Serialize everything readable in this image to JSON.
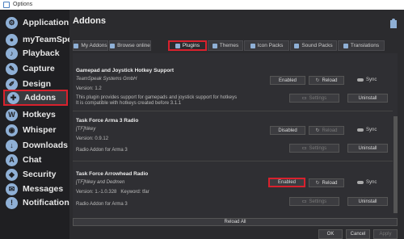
{
  "window": {
    "title": "Options"
  },
  "sidebar": {
    "items": [
      {
        "label": "Application",
        "icon": "gear-icon",
        "glyph": "⚙"
      },
      {
        "label": "myTeamSpeak",
        "icon": "user-icon",
        "glyph": "●"
      },
      {
        "label": "Playback",
        "icon": "speaker-icon",
        "glyph": "♪"
      },
      {
        "label": "Capture",
        "icon": "microphone-icon",
        "glyph": "✎"
      },
      {
        "label": "Design",
        "icon": "brush-icon",
        "glyph": "✐"
      },
      {
        "label": "Addons",
        "icon": "puzzle-icon",
        "glyph": "✚"
      },
      {
        "label": "Hotkeys",
        "icon": "keyboard-icon",
        "glyph": "W"
      },
      {
        "label": "Whisper",
        "icon": "whisper-icon",
        "glyph": "◉"
      },
      {
        "label": "Downloads",
        "icon": "download-icon",
        "glyph": "↓"
      },
      {
        "label": "Chat",
        "icon": "chat-icon",
        "glyph": "A"
      },
      {
        "label": "Security",
        "icon": "shield-icon",
        "glyph": "◆"
      },
      {
        "label": "Messages",
        "icon": "message-icon",
        "glyph": "✉"
      },
      {
        "label": "Notifications",
        "icon": "bell-icon",
        "glyph": "!"
      }
    ]
  },
  "header": {
    "title": "Addons"
  },
  "tabs": [
    {
      "label": "My Addons",
      "icon": "my-addons-icon"
    },
    {
      "label": "Browse online",
      "icon": "browse-icon"
    },
    {
      "label": "Plugins",
      "icon": "plugins-icon"
    },
    {
      "label": "Themes",
      "icon": "themes-icon"
    },
    {
      "label": "Icon Packs",
      "icon": "icon-packs-icon"
    },
    {
      "label": "Sound Packs",
      "icon": "sound-packs-icon"
    },
    {
      "label": "Translations",
      "icon": "translations-icon"
    }
  ],
  "addons": [
    {
      "title": "Gamepad and Joystick Hotkey Support",
      "author": "TeamSpeak Systems GmbH",
      "version": "Version: 1.2",
      "description_line1": "This plugin provides support for gamepads and joystick support for hotkeys",
      "description_line2": "It is compatible with hotkeys created before 3.1.1",
      "state_label": "Enabled",
      "reload_label": "Reload",
      "sync_label": "Sync",
      "settings_label": "Settings",
      "uninstall_label": "Uninstall"
    },
    {
      "title": "Task Force Arma 3 Radio",
      "author": "[TF]Nkey",
      "version": "Version: 0.9.12",
      "description_line1": "Radio Addon for Arma 3",
      "state_label": "Disabled",
      "reload_label": "Reload",
      "sync_label": "Sync",
      "settings_label": "Settings",
      "uninstall_label": "Uninstall"
    },
    {
      "title": "Task Force Arrowhead Radio",
      "author": "[TF]Nkey and Dedmen",
      "version": "Version: 1.-1.0.328",
      "keyword": "Keyword: tfar",
      "description_line1": "Radio Addon for Arma 3",
      "state_label": "Enabled",
      "reload_label": "Reload",
      "sync_label": "Sync",
      "settings_label": "Settings",
      "uninstall_label": "Uninstall"
    }
  ],
  "reload_all_label": "Reload All",
  "footer": {
    "ok": "OK",
    "cancel": "Cancel",
    "apply": "Apply"
  },
  "colors": {
    "highlight": "#d8212d",
    "background": "#2b2b2e",
    "sidebar": "#1f1f22"
  }
}
